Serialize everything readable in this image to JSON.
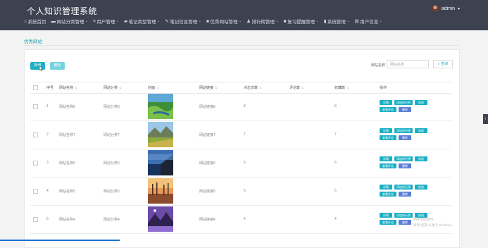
{
  "app": {
    "title": "个人知识管理系统"
  },
  "user": {
    "name": "admin"
  },
  "nav": [
    {
      "label": "系统首页",
      "icon": "home-icon",
      "has_caret": false
    },
    {
      "label": "网站分类管理",
      "icon": "folder-icon",
      "has_caret": true
    },
    {
      "label": "用户管理",
      "icon": "list-icon",
      "has_caret": true
    },
    {
      "label": "笔记类型管理",
      "icon": "bookmark-icon",
      "has_caret": true
    },
    {
      "label": "笔记信息管理",
      "icon": "pen-icon",
      "has_caret": true
    },
    {
      "label": "优秀网站管理",
      "icon": "square-icon",
      "has_caret": true
    },
    {
      "label": "排行榜管理",
      "icon": "person-icon",
      "has_caret": true
    },
    {
      "label": "复习提醒管理",
      "icon": "square-icon",
      "has_caret": true
    },
    {
      "label": "系统管理",
      "icon": "bar-chart-icon",
      "has_caret": true
    },
    {
      "label": "用户信息",
      "icon": "doc-icon",
      "has_caret": true
    }
  ],
  "page": {
    "heading": "优秀网站"
  },
  "toolbar": {
    "add_label": "新增",
    "delete_label": "删除"
  },
  "search": {
    "label": "网站名称",
    "placeholder": "网站名称",
    "button_label": "查询"
  },
  "table": {
    "columns": [
      "序号",
      "网站名称",
      "网站分类",
      "封面",
      "网站链接",
      "点击次数",
      "评论数",
      "收藏数",
      "操作"
    ],
    "actions": [
      "详情",
      "添加排行榜",
      "修改",
      "查看评论",
      "删除"
    ],
    "rows": [
      {
        "index": "1",
        "name": "网站名称8",
        "category": "网站分类8",
        "cover": "green-coast",
        "link": "网站链接8",
        "clicks": "8",
        "comments": "",
        "favorites": "8"
      },
      {
        "index": "2",
        "name": "网站名称7",
        "category": "网站分类7",
        "cover": "mountain-valley",
        "link": "网站链接7",
        "clicks": "7",
        "comments": "",
        "favorites": "7"
      },
      {
        "index": "3",
        "name": "网站名称6",
        "category": "网站分类6",
        "cover": "blue-cliff",
        "link": "网站链接6",
        "clicks": "6",
        "comments": "",
        "favorites": "6"
      },
      {
        "index": "4",
        "name": "网站名称5",
        "category": "网站分类5",
        "cover": "sunset-lake",
        "link": "网站链接5",
        "clicks": "5",
        "comments": "",
        "favorites": "5"
      },
      {
        "index": "5",
        "name": "网站名称4",
        "category": "网站分类4",
        "cover": "purple-peaks",
        "link": "网站链接4",
        "clicks": "4",
        "comments": "",
        "favorites": "4"
      }
    ]
  },
  "watermark": {
    "line1": "Windows",
    "line2": "转到\"设置\"以激活 Windows。"
  },
  "colors": {
    "topbar": "#3d4251",
    "accent": "#1ab0c5",
    "blue": "#5b7ed6"
  }
}
